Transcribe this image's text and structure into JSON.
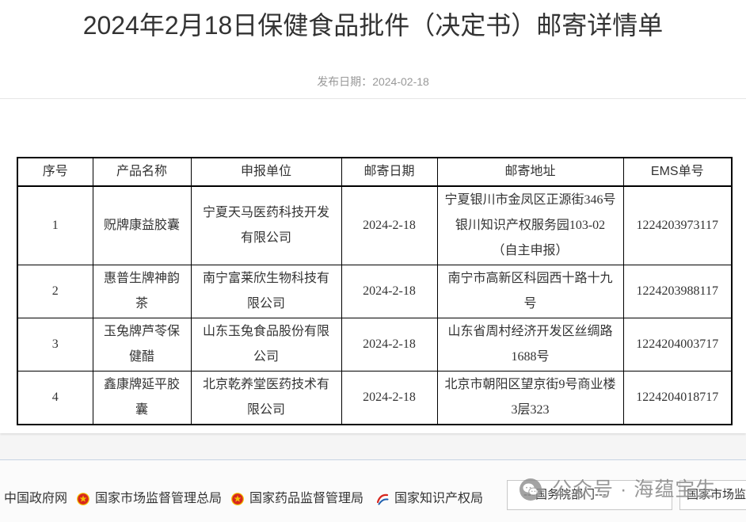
{
  "article": {
    "title": "2024年2月18日保健食品批件（决定书）邮寄详情单",
    "publish_label": "发布日期：",
    "publish_date": "2024-02-18"
  },
  "table": {
    "headers": {
      "no": "序号",
      "product": "产品名称",
      "applicant": "申报单位",
      "mail_date": "邮寄日期",
      "address": "邮寄地址",
      "ems": "EMS单号"
    },
    "rows": [
      {
        "no": "1",
        "product": "贶牌康益胶囊",
        "applicant": "宁夏天马医药科技开发有限公司",
        "mail_date": "2024-2-18",
        "address": "宁夏银川市金凤区正源街346号银川知识产权服务园103-02（自主申报）",
        "ems": "1224203973117"
      },
      {
        "no": "2",
        "product": "惠普生牌神韵茶",
        "applicant": "南宁富莱欣生物科技有限公司",
        "mail_date": "2024-2-18",
        "address": "南宁市高新区科园西十路十九号",
        "ems": "1224203988117"
      },
      {
        "no": "3",
        "product": "玉兔牌芦苓保健醋",
        "applicant": "山东玉兔食品股份有限公司",
        "mail_date": "2024-2-18",
        "address": "山东省周村经济开发区丝绸路1688号",
        "ems": "1224204003717"
      },
      {
        "no": "4",
        "product": "鑫康牌延平胶囊",
        "applicant": "北京乾养堂医药技术有限公司",
        "mail_date": "2024-2-18",
        "address": "北京市朝阳区望京街9号商业楼3层323",
        "ems": "1224204018717"
      }
    ]
  },
  "footer": {
    "links": [
      {
        "label": "中国政府网"
      },
      {
        "label": "国家市场监督管理总局",
        "icon": "national-emblem-icon"
      },
      {
        "label": "国家药品监督管理局",
        "icon": "national-emblem-icon"
      },
      {
        "label": "国家知识产权局",
        "icon": "cnipa-logo-icon"
      }
    ],
    "selects": [
      {
        "selected": "---国务院部门---"
      },
      {
        "selected": "国家市场监督"
      }
    ]
  },
  "watermark": {
    "icon": "wechat-icon",
    "text": "公众号 · 海蕴宝生"
  },
  "colors": {
    "title_text": "#333333",
    "date_text": "#999999",
    "table_border": "#000000",
    "footer_border": "#c7d3e3",
    "watermark_text": "#7f7f7f",
    "emblem_red": "#d7261e",
    "emblem_gold": "#f2c200"
  }
}
